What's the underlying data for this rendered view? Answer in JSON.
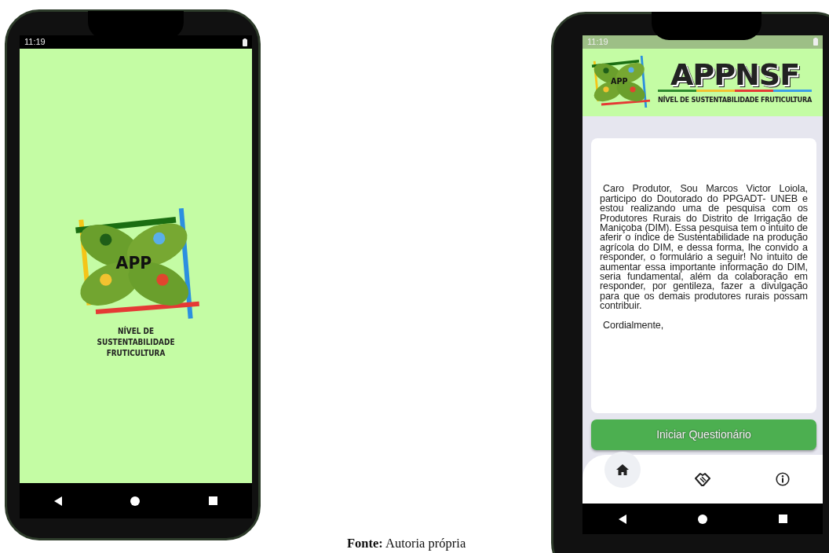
{
  "phones": [
    {
      "kind": "splash",
      "status_time": "11:19",
      "logo_text": "APP",
      "subtitle": "NÍVEL DE SUSTENTABILIDADE FRUTICULTURA"
    },
    {
      "kind": "home",
      "status_time": "11:19",
      "header": {
        "logo_text": "APP",
        "title": "APPNSF",
        "subtitle": "NÍVEL DE SUSTENTABILIDADE FRUTICULTURA"
      },
      "message": [
        "Caro Produtor, Sou Marcos Victor Loiola, participo do Doutorado do PPGADT- UNEB e estou realizando uma de pesquisa com os Produtores Rurais do Distrito de Irrigação de Maniçoba (DIM). Essa pesquisa tem o intuito de aferir o índice de Sustentabilidade na produção agrícola do DIM, e dessa forma, lhe convido a responder, o formulário a seguir! No intuito de aumentar essa importante informação do DIM, seria fundamental, além da colaboração em responder, por gentileza, fazer a divulgação para que os demais produtores rurais possam contribuir.",
        "Cordialmente,"
      ],
      "button": "Iniciar Questionário",
      "tabs": [
        {
          "selected": true
        },
        {
          "selected": false
        },
        {
          "selected": false
        }
      ]
    }
  ],
  "caption": "**Fonte:** Autoria própria"
}
